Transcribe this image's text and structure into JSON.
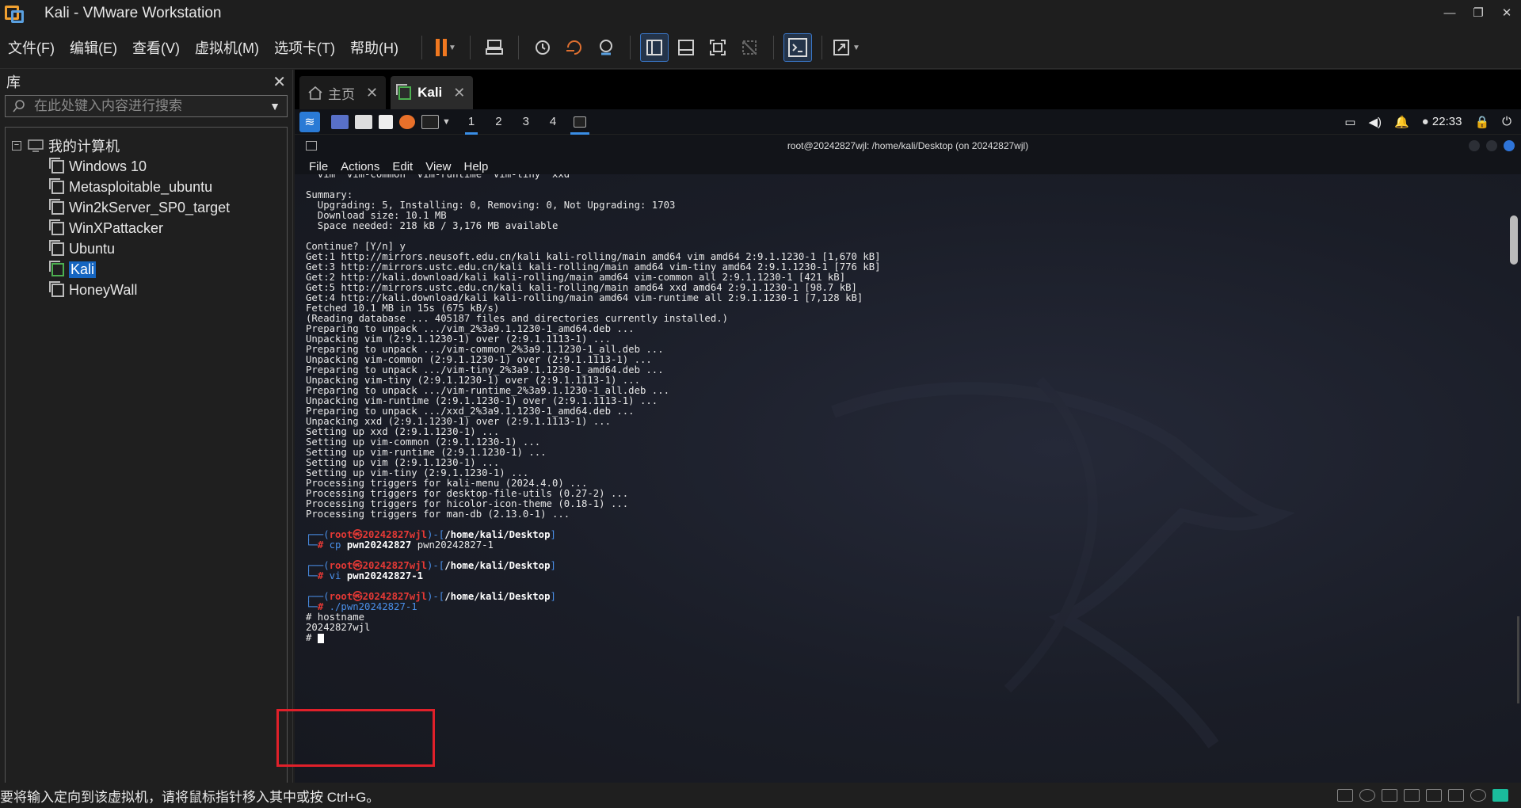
{
  "window": {
    "title": "Kali - VMware Workstation"
  },
  "menu": [
    "文件(F)",
    "编辑(E)",
    "查看(V)",
    "虚拟机(M)",
    "选项卡(T)",
    "帮助(H)"
  ],
  "library": {
    "title": "库",
    "search_placeholder": "在此处键入内容进行搜索",
    "root": "我的计算机",
    "vms": [
      "Windows 10",
      "Metasploitable_ubuntu",
      "Win2kServer_SP0_target",
      "WinXPattacker",
      "Ubuntu",
      "Kali",
      "HoneyWall"
    ],
    "selected": "Kali"
  },
  "tabs": [
    {
      "label": "主页",
      "icon": "home-icon"
    },
    {
      "label": "Kali",
      "icon": "vm-running-icon",
      "active": true
    }
  ],
  "guest_panel": {
    "workspaces": [
      "1",
      "2",
      "3",
      "4"
    ],
    "active_workspace": "1",
    "clock": "22:33"
  },
  "terminal": {
    "title": "root@20242827wjl: /home/kali/Desktop (on 20242827wjl)",
    "menu": [
      "File",
      "Actions",
      "Edit",
      "View",
      "Help"
    ],
    "output": "  vim  vim-common  vim-runtime  vim-tiny  xxd\n\nSummary:\n  Upgrading: 5, Installing: 0, Removing: 0, Not Upgrading: 1703\n  Download size: 10.1 MB\n  Space needed: 218 kB / 3,176 MB available\n\nContinue? [Y/n] y\nGet:1 http://mirrors.neusoft.edu.cn/kali kali-rolling/main amd64 vim amd64 2:9.1.1230-1 [1,670 kB]\nGet:3 http://mirrors.ustc.edu.cn/kali kali-rolling/main amd64 vim-tiny amd64 2:9.1.1230-1 [776 kB]\nGet:2 http://kali.download/kali kali-rolling/main amd64 vim-common all 2:9.1.1230-1 [421 kB]\nGet:5 http://mirrors.ustc.edu.cn/kali kali-rolling/main amd64 xxd amd64 2:9.1.1230-1 [98.7 kB]\nGet:4 http://kali.download/kali kali-rolling/main amd64 vim-runtime all 2:9.1.1230-1 [7,128 kB]\nFetched 10.1 MB in 15s (675 kB/s)\n(Reading database ... 405187 files and directories currently installed.)\nPreparing to unpack .../vim_2%3a9.1.1230-1_amd64.deb ...\nUnpacking vim (2:9.1.1230-1) over (2:9.1.1113-1) ...\nPreparing to unpack .../vim-common_2%3a9.1.1230-1_all.deb ...\nUnpacking vim-common (2:9.1.1230-1) over (2:9.1.1113-1) ...\nPreparing to unpack .../vim-tiny_2%3a9.1.1230-1_amd64.deb ...\nUnpacking vim-tiny (2:9.1.1230-1) over (2:9.1.1113-1) ...\nPreparing to unpack .../vim-runtime_2%3a9.1.1230-1_all.deb ...\nUnpacking vim-runtime (2:9.1.1230-1) over (2:9.1.1113-1) ...\nPreparing to unpack .../xxd_2%3a9.1.1230-1_amd64.deb ...\nUnpacking xxd (2:9.1.1230-1) over (2:9.1.1113-1) ...\nSetting up xxd (2:9.1.1230-1) ...\nSetting up vim-common (2:9.1.1230-1) ...\nSetting up vim-runtime (2:9.1.1230-1) ...\nSetting up vim (2:9.1.1230-1) ...\nSetting up vim-tiny (2:9.1.1230-1) ...\nProcessing triggers for kali-menu (2024.4.0) ...\nProcessing triggers for desktop-file-utils (0.27-2) ...\nProcessing triggers for hicolor-icon-theme (0.18-1) ...\nProcessing triggers for man-db (2.13.0-1) ...",
    "prompt_user": "root",
    "prompt_host": "20242827wjl",
    "prompt_path": "/home/kali/Desktop",
    "cmd1_name": "cp",
    "cmd1_arg1": "pwn20242827",
    "cmd1_arg2": "pwn20242827-1",
    "cmd2_name": "vi",
    "cmd2_arg": "pwn20242827-1",
    "cmd3": "./pwn20242827-1",
    "shell_cmd": "# hostname",
    "shell_out": "20242827wjl",
    "shell_prompt": "#"
  },
  "statusbar": {
    "text": "要将输入定向到该虚拟机，请将鼠标指针移入其中或按 Ctrl+G。"
  },
  "colors": {
    "accent": "#1565c0",
    "highlight_box": "#e0202a",
    "terminal_blue": "#4a8fe8",
    "terminal_red": "#e53935"
  }
}
